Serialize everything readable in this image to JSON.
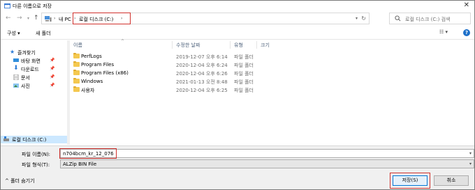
{
  "window": {
    "title": "다른 이름으로 저장",
    "close_glyph": "✕"
  },
  "address": {
    "crumbs": [
      "내 PC",
      "로컬 디스크 (C:)"
    ],
    "search_placeholder": "로컬 디스크 (C:) 검색"
  },
  "toolbar": {
    "organize_label": "구성 ▾",
    "new_folder_label": "새 폴더",
    "view_glyph": "☷ ▾",
    "help_glyph": "?"
  },
  "navpane": {
    "items": [
      {
        "label": "즐겨찾기",
        "icon": "star-icon"
      },
      {
        "label": "바탕 화면",
        "icon": "desktop-icon"
      },
      {
        "label": "다운로드",
        "icon": "download-icon"
      },
      {
        "label": "문서",
        "icon": "document-icon"
      },
      {
        "label": "사진",
        "icon": "pictures-icon"
      },
      {
        "label": "로컬 디스크 (C:)",
        "icon": "drive-icon"
      }
    ]
  },
  "filelist": {
    "columns": [
      "이름",
      "수정한 날짜",
      "유형",
      "크기"
    ],
    "rows": [
      {
        "name": "PerfLogs",
        "date": "2019-12-07 오후 6:14",
        "type": "파일 폴더"
      },
      {
        "name": "Program Files",
        "date": "2020-12-04 오후 6:24",
        "type": "파일 폴더"
      },
      {
        "name": "Program Files (x86)",
        "date": "2020-12-04 오후 6:26",
        "type": "파일 폴더"
      },
      {
        "name": "Windows",
        "date": "2021-01-13 오전 8:48",
        "type": "파일 폴더"
      },
      {
        "name": "사용자",
        "date": "2020-12-04 오후 6:25",
        "type": "파일 폴더"
      }
    ]
  },
  "fields": {
    "filename_label": "파일 이름(N):",
    "filename_value": "n704bcm_kr_12_076",
    "filetype_label": "파일 형식(T):",
    "filetype_value": "ALZip BIN File"
  },
  "footer": {
    "hide_folders_label": "^  폴더 숨기기",
    "save_label": "저장(S)",
    "cancel_label": "취소"
  },
  "colors": {
    "highlight_red": "#d0312d",
    "selection_blue": "#cce8ff",
    "folder_yellow": "#f4c84f"
  }
}
